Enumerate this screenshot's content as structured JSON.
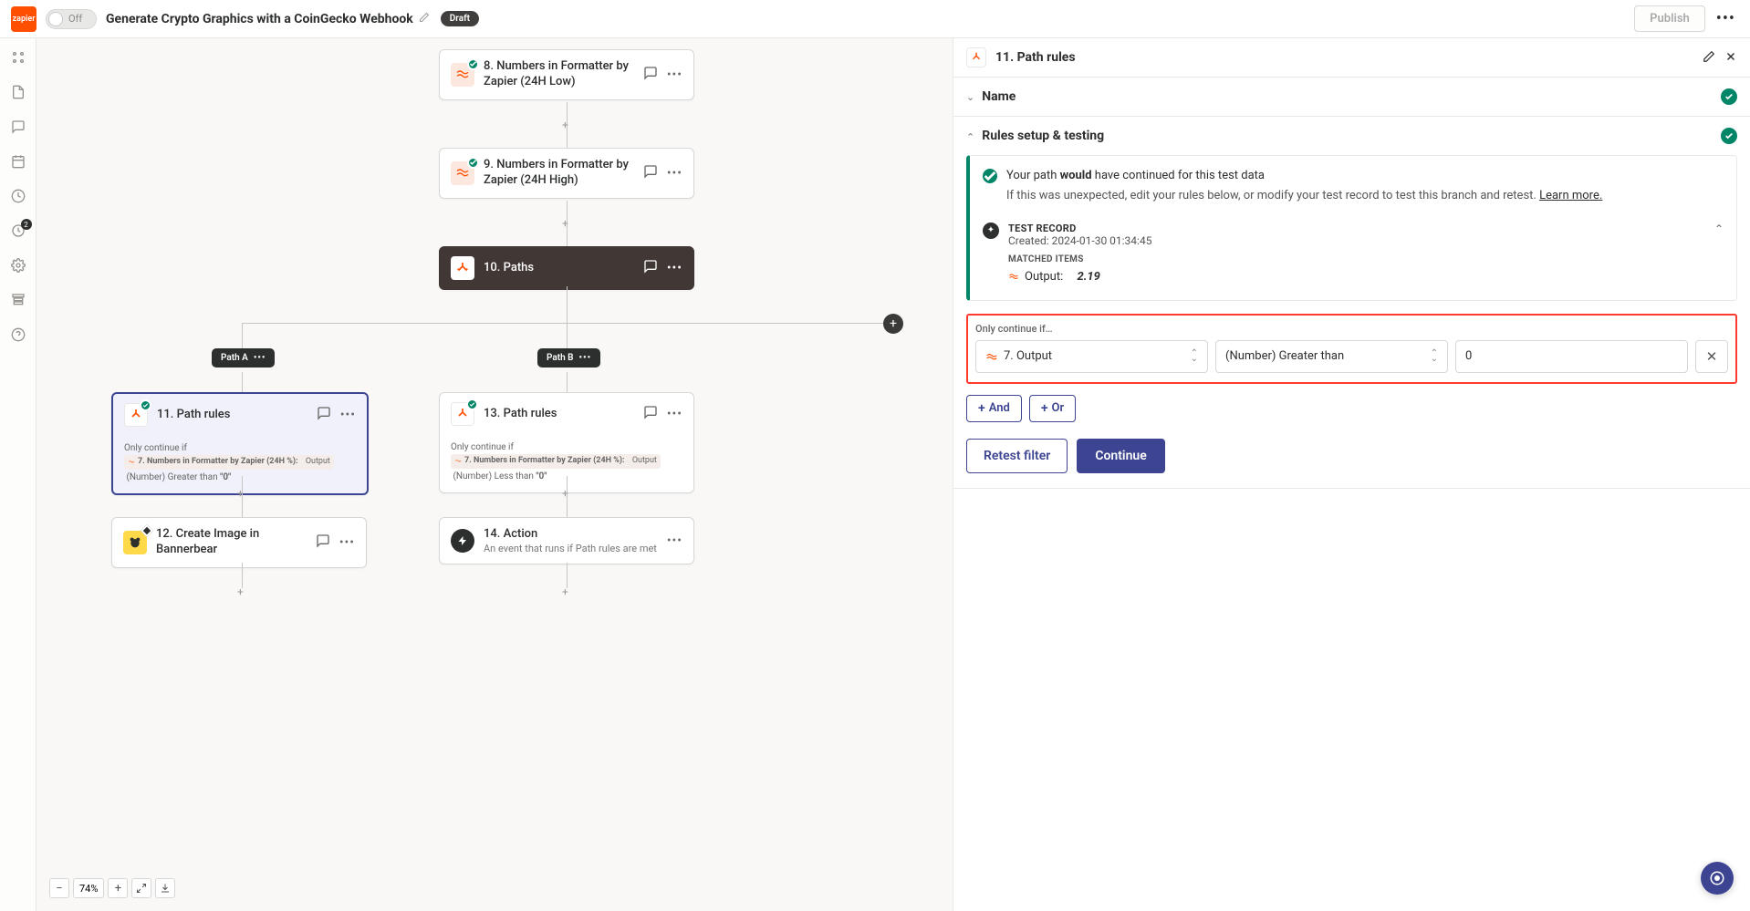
{
  "header": {
    "logo_text": "zapier",
    "toggle_label": "Off",
    "title": "Generate Crypto Graphics with a CoinGecko Webhook",
    "draft_badge": "Draft",
    "publish_label": "Publish"
  },
  "sidebar": {
    "tasks_badge": "2"
  },
  "canvas": {
    "zoom_pct": "74%",
    "nodes": {
      "n8": {
        "title": "8. Numbers in Formatter by Zapier (24H Low)"
      },
      "n9": {
        "title": "9. Numbers in Formatter by Zapier (24H High)"
      },
      "n10": {
        "title": "10. Paths"
      },
      "n11": {
        "title": "11. Path rules",
        "detail_intro": "Only continue if",
        "chip": "7. Numbers in Formatter by Zapier (24H %):",
        "chip_suffix": "Output",
        "cond_text1": "(Number)",
        "cond_text2": "Greater than",
        "cond_val": "\"0\""
      },
      "n12": {
        "title": "12. Create Image in Bannerbear"
      },
      "n13": {
        "title": "13. Path rules",
        "detail_intro": "Only continue if",
        "chip": "7. Numbers in Formatter by Zapier (24H %):",
        "chip_suffix": "Output",
        "cond_text1": "(Number)",
        "cond_text2": "Less than",
        "cond_val": "\"0\""
      },
      "n14": {
        "title": "14. Action",
        "sub": "An event that runs if Path rules are met"
      }
    },
    "path_a": "Path A",
    "path_b": "Path B"
  },
  "panel": {
    "title": "11. Path rules",
    "sections": {
      "name": "Name",
      "rules": "Rules setup & testing"
    },
    "test": {
      "headline_pre": "Your path ",
      "headline_bold": "would",
      "headline_post": " have continued for this test data",
      "sub": "If this was unexpected, edit your rules below, or modify your test record to test this branch and retest.",
      "learn_more": "Learn more.",
      "record_label": "TEST RECORD",
      "record_date": "Created: 2024-01-30 01:34:45",
      "matched_label": "MATCHED ITEMS",
      "matched_item": "Output:",
      "matched_value": "2.19"
    },
    "condition": {
      "label": "Only continue if…",
      "field_display": "7. Output",
      "operator": "(Number) Greater than",
      "value": "0"
    },
    "logic": {
      "and": "And",
      "or": "Or"
    },
    "actions": {
      "retest": "Retest filter",
      "continue": "Continue"
    }
  }
}
